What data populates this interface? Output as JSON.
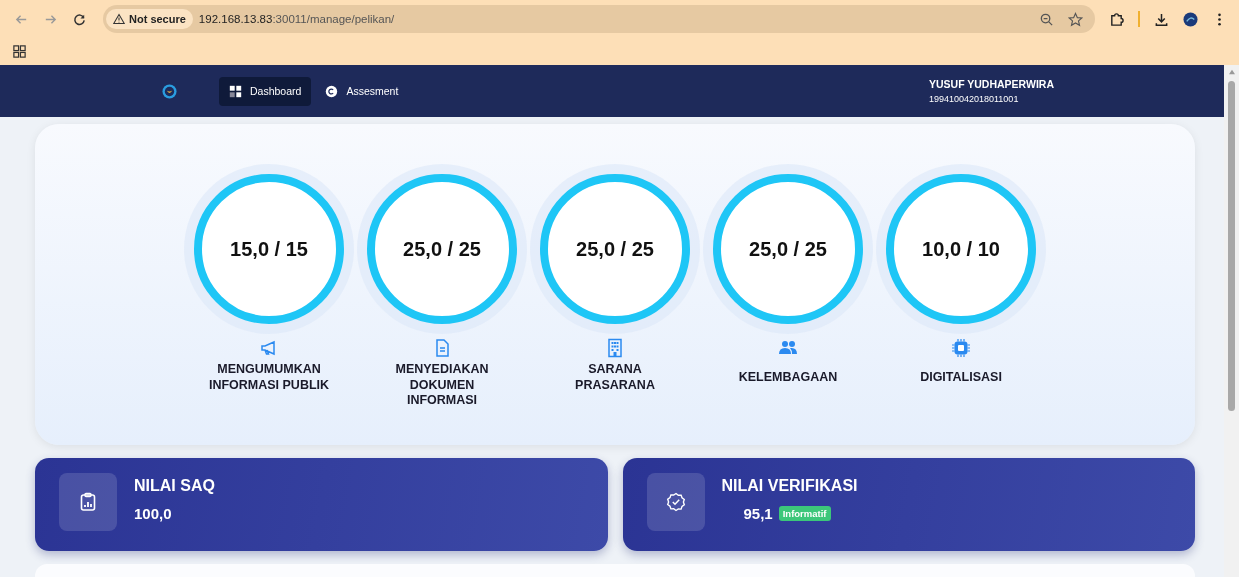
{
  "browser": {
    "security": "Not secure",
    "url_host": "192.168.13.83",
    "url_path": ":30011/manage/pelikan/"
  },
  "nav": {
    "items": [
      {
        "label": "Dashboard",
        "selected": true
      },
      {
        "label": "Assesment",
        "selected": false
      }
    ],
    "user": {
      "name": "YUSUF YUDHAPERWIRA",
      "id": "199410042018011001"
    }
  },
  "scores": [
    {
      "value": "15,0 / 15",
      "label": "MENGUMUMKAN INFORMASI PUBLIK"
    },
    {
      "value": "25,0 / 25",
      "label": "MENYEDIAKAN DOKUMEN INFORMASI"
    },
    {
      "value": "25,0 / 25",
      "label": "SARANA PRASARANA"
    },
    {
      "value": "25,0 / 25",
      "label": "KELEMBAGAAN"
    },
    {
      "value": "10,0 / 10",
      "label": "DIGITALISASI"
    }
  ],
  "summary": [
    {
      "title": "NILAI SAQ",
      "value": "100,0"
    },
    {
      "title": "NILAI VERIFIKASI",
      "value": "95,1",
      "badge": "Informatif"
    }
  ]
}
